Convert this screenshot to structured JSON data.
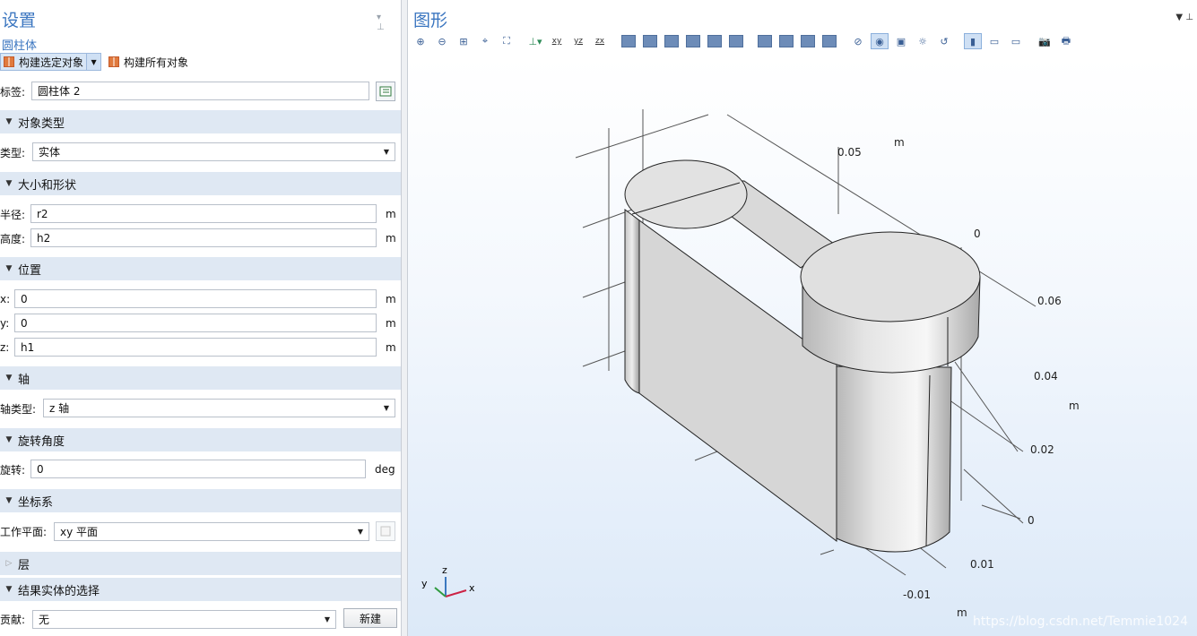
{
  "settings": {
    "title": "设置",
    "subtitle": "圆柱体",
    "build_selected": "构建选定对象",
    "build_all": "构建所有对象",
    "label": {
      "label": "标签:",
      "value": "圆柱体 2"
    },
    "object_type": {
      "section": "对象类型",
      "label": "类型:",
      "value": "实体"
    },
    "size_shape": {
      "section": "大小和形状",
      "radius_label": "半径:",
      "radius_value": "r2",
      "radius_unit": "m",
      "height_label": "高度:",
      "height_value": "h2",
      "height_unit": "m"
    },
    "position": {
      "section": "位置",
      "x_label": "x:",
      "x_value": "0",
      "x_unit": "m",
      "y_label": "y:",
      "y_value": "0",
      "y_unit": "m",
      "z_label": "z:",
      "z_value": "h1",
      "z_unit": "m"
    },
    "axis": {
      "section": "轴",
      "label": "轴类型:",
      "value": "z 轴"
    },
    "rotation": {
      "section": "旋转角度",
      "label": "旋转:",
      "value": "0",
      "unit": "deg"
    },
    "coord": {
      "section": "坐标系",
      "label": "工作平面:",
      "value": "xy 平面"
    },
    "layers": {
      "section": "层"
    },
    "result": {
      "section": "结果实体的选择",
      "label": "贡献:",
      "value": "无",
      "new_button": "新建"
    }
  },
  "graphics": {
    "title": "图形",
    "axis_labels": {
      "top_m": "m",
      "z_005": "0.05",
      "z_0": "0",
      "y_006": "0.06",
      "y_004": "0.04",
      "y_m": "m",
      "y_002": "0.02",
      "y_0": "0",
      "x_001": "0.01",
      "x_n001": "-0.01",
      "x_m": "m"
    },
    "triad": {
      "x": "x",
      "y": "y",
      "z": "z"
    },
    "watermark": "https://blog.csdn.net/Temmie1024"
  }
}
